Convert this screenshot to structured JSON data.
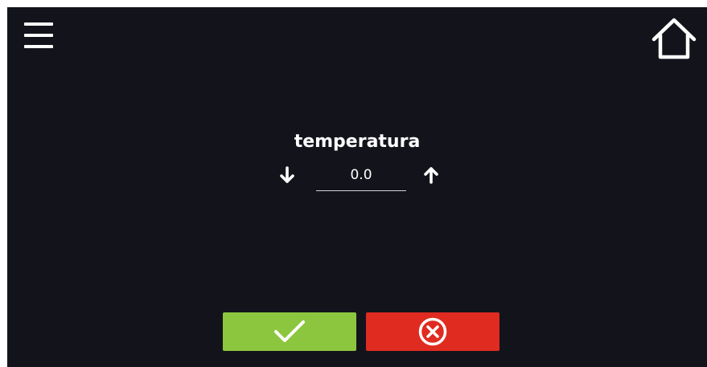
{
  "header": {
    "menu_icon": "hamburger-menu-icon",
    "home_icon": "home-icon"
  },
  "editor": {
    "label": "temperatura",
    "value": "0.0",
    "decrease_icon": "arrow-down-icon",
    "increase_icon": "arrow-up-icon"
  },
  "actions": {
    "confirm_icon": "checkmark-icon",
    "cancel_icon": "circle-x-icon"
  },
  "colors": {
    "background": "#13141b",
    "text": "#ffffff",
    "confirm": "#8cc63e",
    "cancel": "#e02b20"
  }
}
